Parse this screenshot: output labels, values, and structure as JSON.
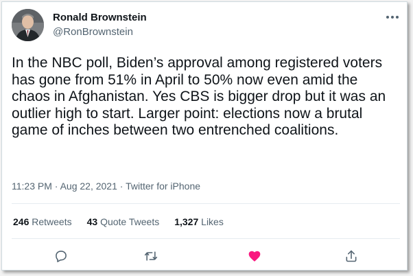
{
  "author": {
    "name": "Ronald Brownstein",
    "handle": "@RonBrownstein"
  },
  "tweet": {
    "text": "In the NBC poll, Biden’s approval among registered voters has gone from 51% in April to 50% now even amid the chaos in Afghanistan. Yes CBS is bigger drop but it was an outlier high to start. Larger point: elections now a brutal game of inches between two entrenched coalitions.",
    "time": "11:23 PM",
    "date": "Aug 22, 2021",
    "source": "Twitter for iPhone",
    "separator": "·"
  },
  "stats": {
    "retweets_count": "246",
    "retweets_label": "Retweets",
    "quotes_count": "43",
    "quotes_label": "Quote Tweets",
    "likes_count": "1,327",
    "likes_label": "Likes"
  },
  "actions": {
    "reply_icon": "reply-icon",
    "retweet_icon": "retweet-icon",
    "like_icon": "heart-icon",
    "share_icon": "share-icon",
    "liked": true
  },
  "colors": {
    "like_active": "#f91880",
    "icon_gray": "#536471",
    "text_primary": "#0f1419"
  }
}
